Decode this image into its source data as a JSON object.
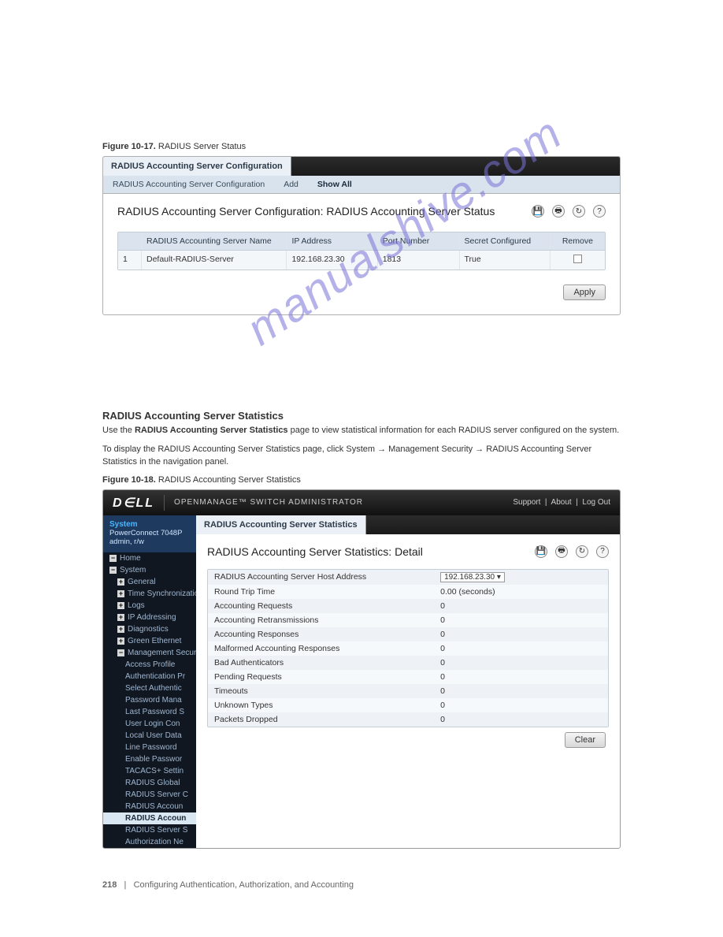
{
  "doc": {
    "fig1_num": "Figure 10-17.",
    "fig1_title": "RADIUS Server Status",
    "fig2_num": "Figure 10-18.",
    "fig2_title": "RADIUS Accounting Server Statistics",
    "section_heading": "RADIUS Accounting Server Statistics",
    "section_text1": "Use the ",
    "section_text_bold": "RADIUS Accounting Server Statistics",
    "section_text2": " page to view statistical information for each RADIUS server configured on the system.",
    "section_nav": "To display the RADIUS Accounting Server Statistics page, click System → Management Security → RADIUS Accounting Server Statistics in the navigation panel.",
    "page_no": "218",
    "page_area": "Configuring Authentication, Authorization, and Accounting",
    "watermark": "manualshive.com"
  },
  "panel1": {
    "tab": "RADIUS Accounting Server Configuration",
    "subtabs": {
      "a": "RADIUS Accounting Server Configuration",
      "b": "Add",
      "c": "Show All"
    },
    "title": "RADIUS Accounting Server Configuration: RADIUS Accounting Server Status",
    "cols": {
      "idx": "",
      "name": "RADIUS Accounting Server Name",
      "ip": "IP Address",
      "port": "Port Number",
      "secret": "Secret Configured",
      "remove": "Remove"
    },
    "row": {
      "idx": "1",
      "name": "Default-RADIUS-Server",
      "ip": "192.168.23.30",
      "port": "1813",
      "secret": "True"
    },
    "apply": "Apply"
  },
  "panel2": {
    "brand": "OPENMANAGE™ SWITCH ADMINISTRATOR",
    "topnav": {
      "support": "Support",
      "about": "About",
      "logout": "Log Out"
    },
    "sys": {
      "label": "System",
      "model": "PowerConnect 7048P",
      "user": "admin, r/w"
    },
    "nav": {
      "home": "Home",
      "system": "System",
      "general": "General",
      "timesync": "Time Synchronization",
      "logs": "Logs",
      "ipaddr": "IP Addressing",
      "diag": "Diagnostics",
      "green": "Green Ethernet",
      "mgmtsec": "Management Security",
      "items": [
        "Access Profile",
        "Authentication Pr",
        "Select Authentic",
        "Password Mana",
        "Last Password S",
        "User Login Con",
        "Local User Data",
        "Line Password",
        "Enable Passwor",
        "TACACS+ Settin",
        "RADIUS Global",
        "RADIUS Server C",
        "RADIUS Accoun",
        "RADIUS Accoun",
        "RADIUS Server S",
        "Authorization Ne"
      ]
    },
    "tab": "RADIUS Accounting Server Statistics",
    "title": "RADIUS Accounting Server Statistics: Detail",
    "fields": {
      "hostaddr_l": "RADIUS Accounting Server Host Address",
      "hostaddr_v": "192.168.23.30",
      "rtt_l": "Round Trip Time",
      "rtt_v": "0.00   (seconds)",
      "areq_l": "Accounting Requests",
      "areq_v": "0",
      "aret_l": "Accounting Retransmissions",
      "aret_v": "0",
      "ares_l": "Accounting Responses",
      "ares_v": "0",
      "mal_l": "Malformed Accounting Responses",
      "mal_v": "0",
      "bad_l": "Bad Authenticators",
      "bad_v": "0",
      "pend_l": "Pending Requests",
      "pend_v": "0",
      "to_l": "Timeouts",
      "to_v": "0",
      "unk_l": "Unknown Types",
      "unk_v": "0",
      "pd_l": "Packets Dropped",
      "pd_v": "0"
    },
    "clear": "Clear"
  }
}
